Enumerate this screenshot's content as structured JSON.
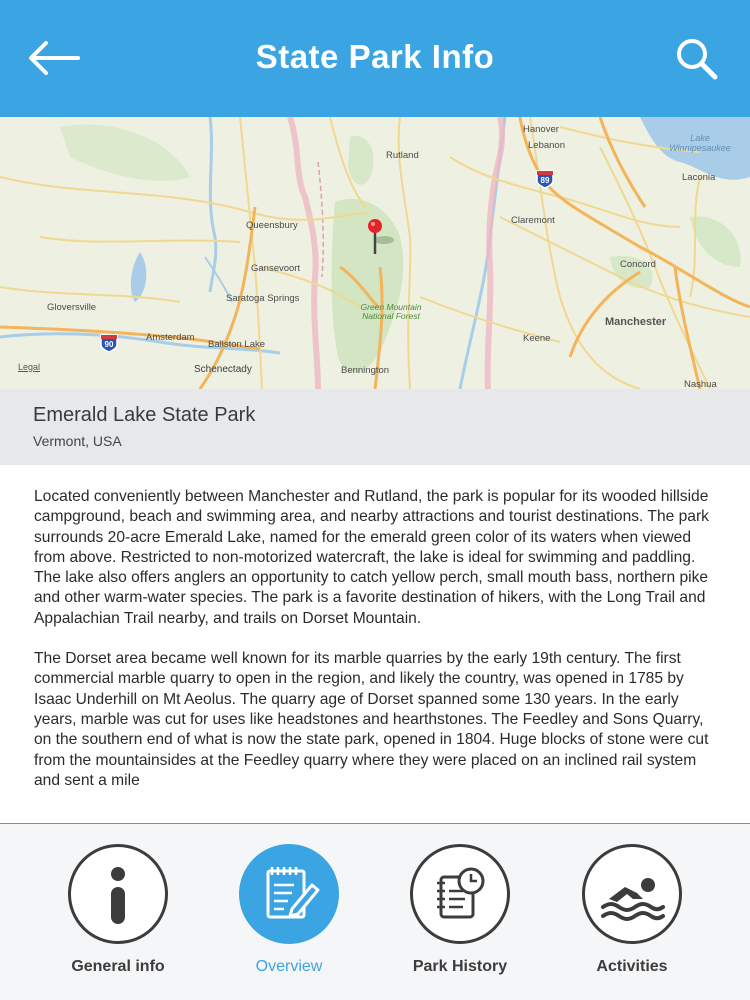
{
  "header": {
    "title": "State Park Info",
    "back_icon": "back-arrow-icon",
    "search_icon": "search-icon",
    "color": "#3ba4e3"
  },
  "map": {
    "legal": "Legal",
    "places": {
      "hanover": "Hanover",
      "lebanon": "Lebanon",
      "rutland": "Rutland",
      "lake_winnipesaukee_1": "Lake",
      "lake_winnipesaukee_2": "Winnipesaukee",
      "laconia": "Laconia",
      "i89": "89",
      "queensbury": "Queensbury",
      "claremont": "Claremont",
      "gansevoort": "Gansevoort",
      "concord": "Concord",
      "saratoga": "Saratoga Springs",
      "gloversville": "Gloversville",
      "gm_forest_1": "Green Mountain",
      "gm_forest_2": "National Forest",
      "manchester": "Manchester",
      "amsterdam": "Amsterdam",
      "ballston": "Ballston Lake",
      "keene": "Keene",
      "i90": "90",
      "schenectady": "Schenectady",
      "bennington": "Bennington",
      "nashua": "Nashua"
    },
    "pin_icon": "map-pin-icon"
  },
  "park": {
    "name": "Emerald Lake State Park",
    "location": "Vermont, USA"
  },
  "description": {
    "p1": "Located conveniently between Manchester and Rutland, the park is popular for its wooded hillside campground, beach and swimming area, and nearby attractions and tourist destinations. The park surrounds 20-acre Emerald Lake, named for the emerald green color of its waters when viewed from above. Restricted to non-motorized watercraft, the lake is ideal for swimming and paddling. The lake also offers anglers an opportunity to catch yellow perch, small mouth bass, northern pike and other warm-water species. The park is a favorite destination of hikers, with the Long Trail and Appalachian Trail nearby, and trails on Dorset Mountain.",
    "p2": "The Dorset area became well known for its marble quarries by the early 19th century. The first commercial marble quarry to open in the region, and likely the country, was opened in 1785 by Isaac Underhill on Mt Aeolus. The quarry age of Dorset spanned some 130 years.  In the early years, marble was cut for uses like headstones and hearthstones. The Feedley and Sons Quarry, on the southern end of what is now the state park, opened in 1804. Huge blocks of stone were cut from the mountainsides at the Feedley quarry where they were placed on an inclined rail system and sent a mile"
  },
  "tabs": [
    {
      "label": "General info",
      "icon": "info-icon",
      "active": false
    },
    {
      "label": "Overview",
      "icon": "notepad-pencil-icon",
      "active": true
    },
    {
      "label": "Park History",
      "icon": "clock-notebook-icon",
      "active": false
    },
    {
      "label": "Activities",
      "icon": "swimmer-icon",
      "active": false
    }
  ],
  "colors": {
    "accent": "#3ba4e3",
    "inactive": "#3c3c3c"
  }
}
